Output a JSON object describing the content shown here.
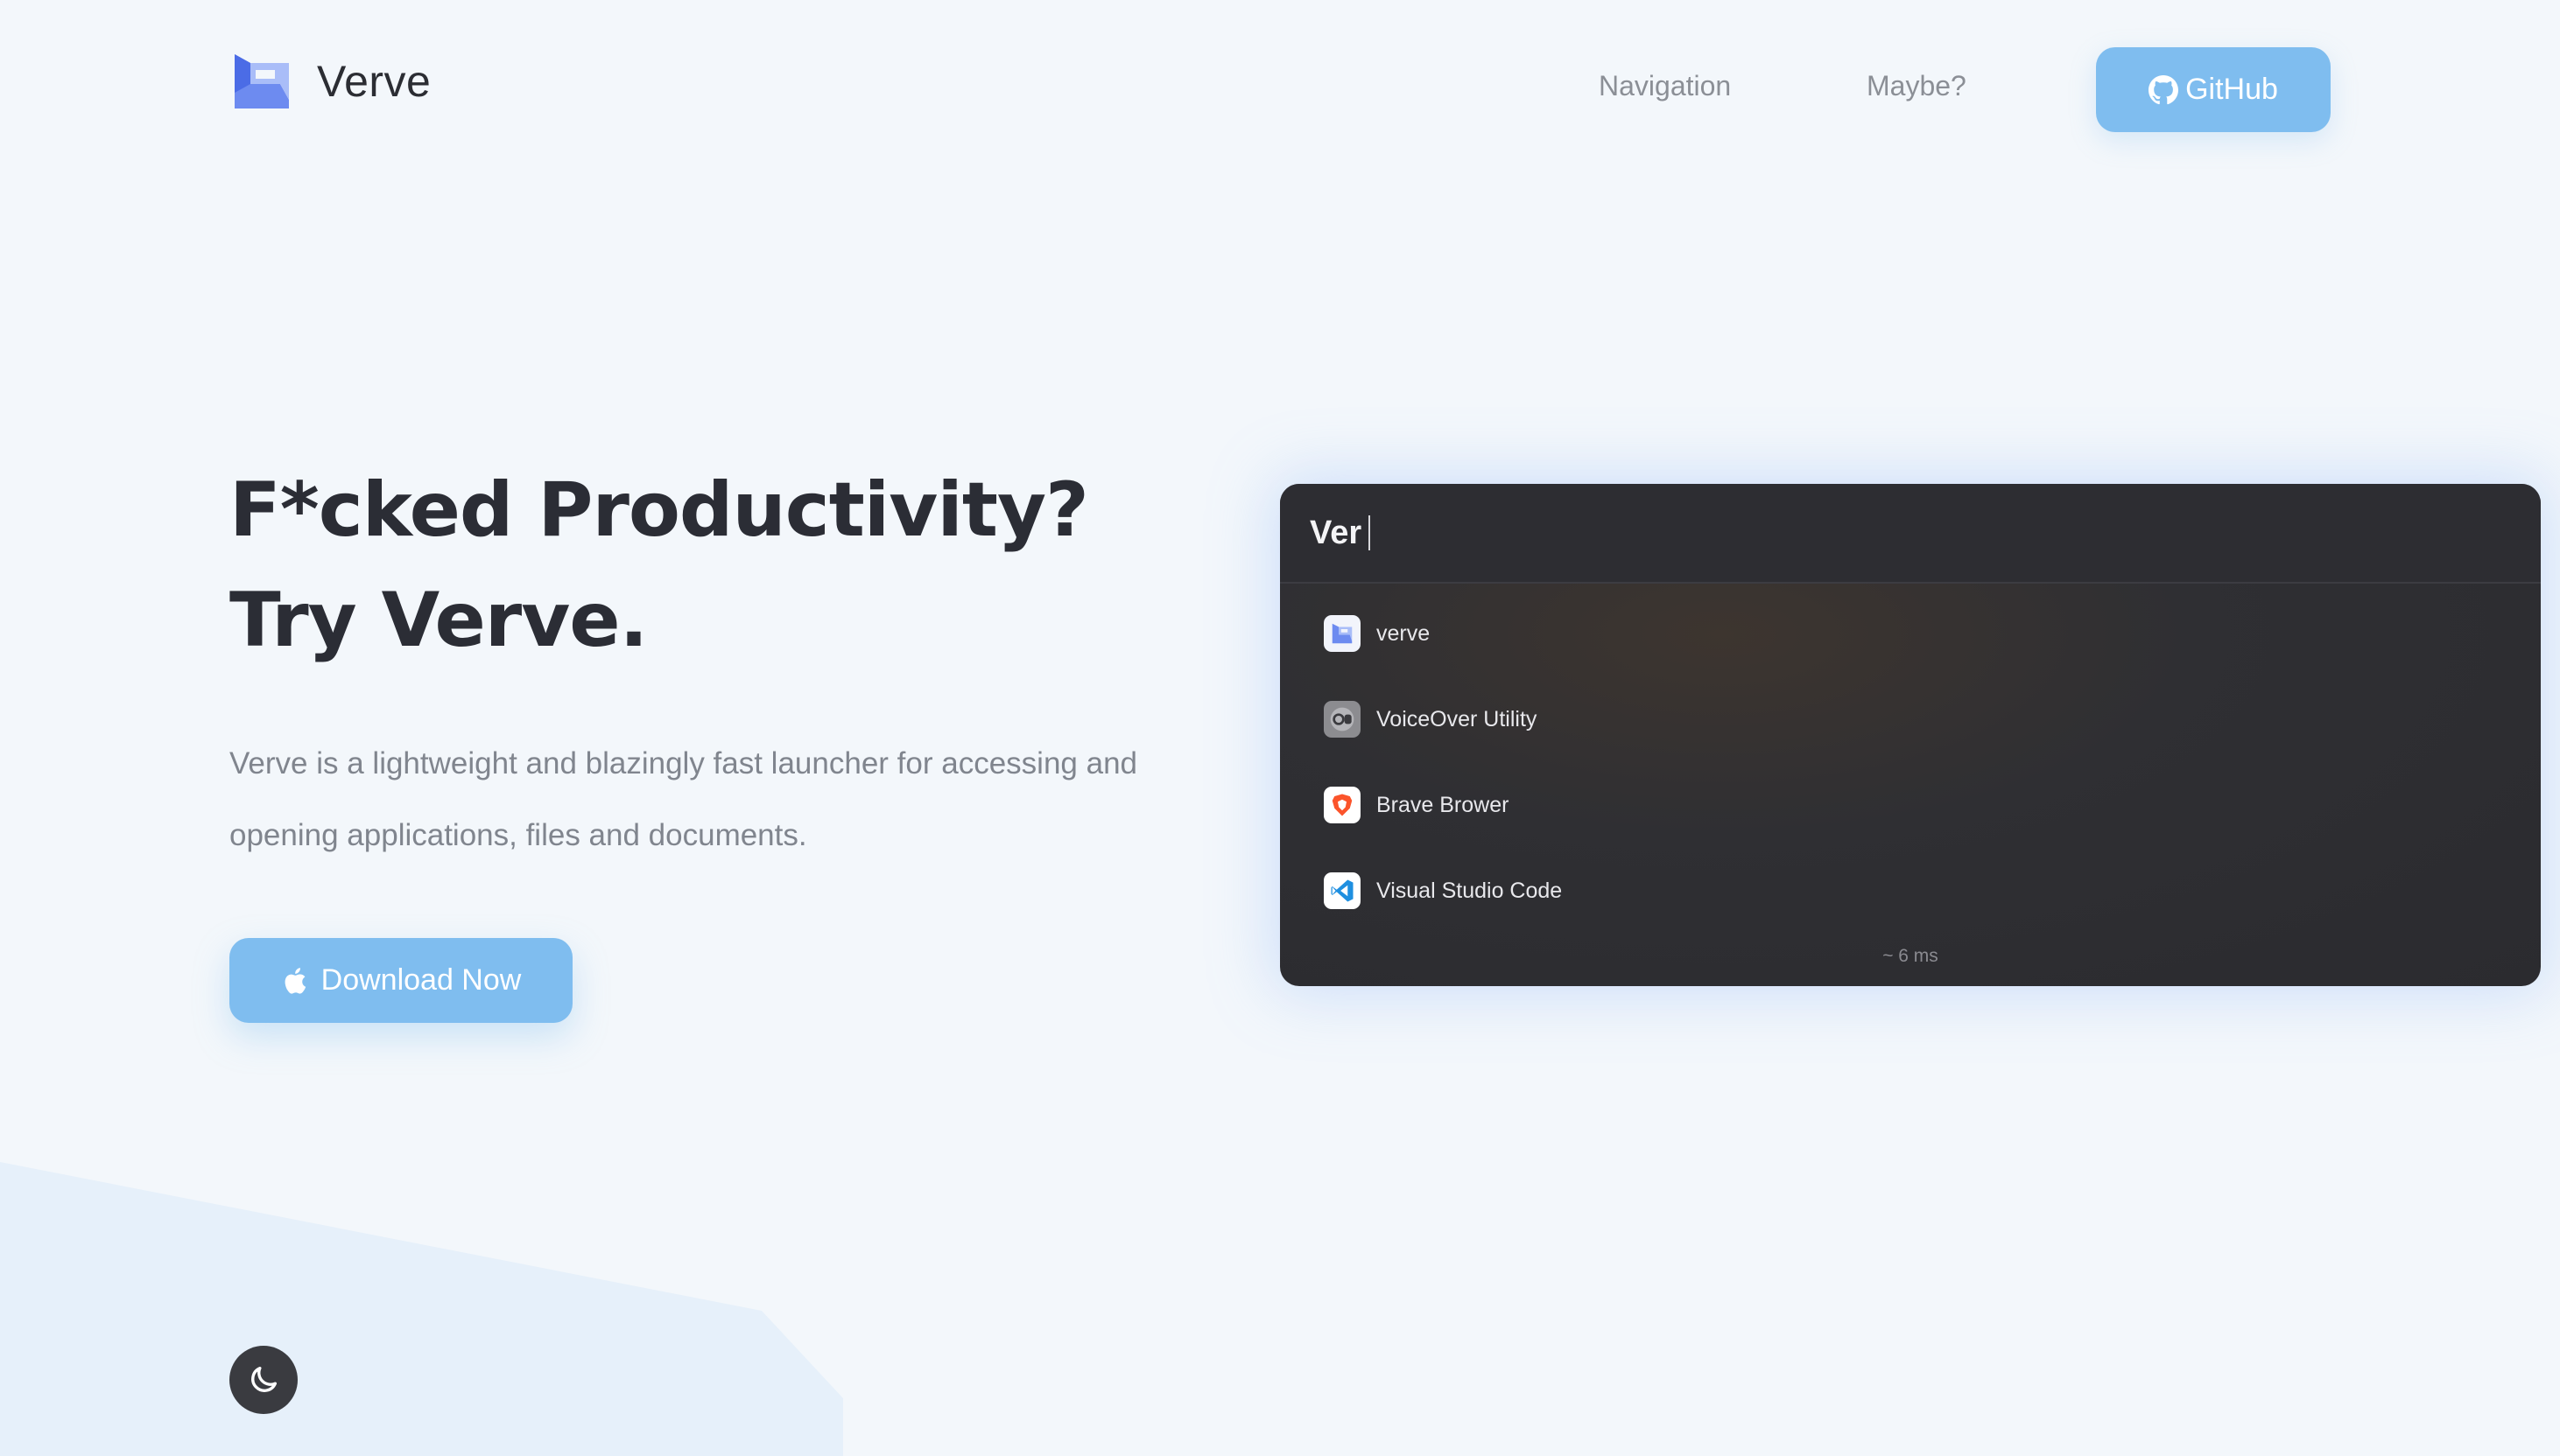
{
  "brand": {
    "name": "Verve",
    "accent": "#7fbdef"
  },
  "nav": {
    "links": [
      "Navigation",
      "Maybe?"
    ],
    "github_label": "GitHub"
  },
  "hero": {
    "title_line1": "F*cked Productivity?",
    "title_line2": "Try Verve.",
    "description": "Verve is a lightweight and blazingly fast launcher for accessing and opening applications, files and documents.",
    "download_label": "Download Now"
  },
  "launcher": {
    "query": "Ver",
    "results": [
      {
        "label": "verve",
        "icon": "verve-app-icon"
      },
      {
        "label": "VoiceOver Utility",
        "icon": "voiceover-icon"
      },
      {
        "label": "Brave Brower",
        "icon": "brave-icon"
      },
      {
        "label": "Visual Studio Code",
        "icon": "vscode-icon"
      }
    ],
    "timing": "~ 6 ms"
  },
  "theme_toggle": {
    "icon": "moon-icon"
  }
}
